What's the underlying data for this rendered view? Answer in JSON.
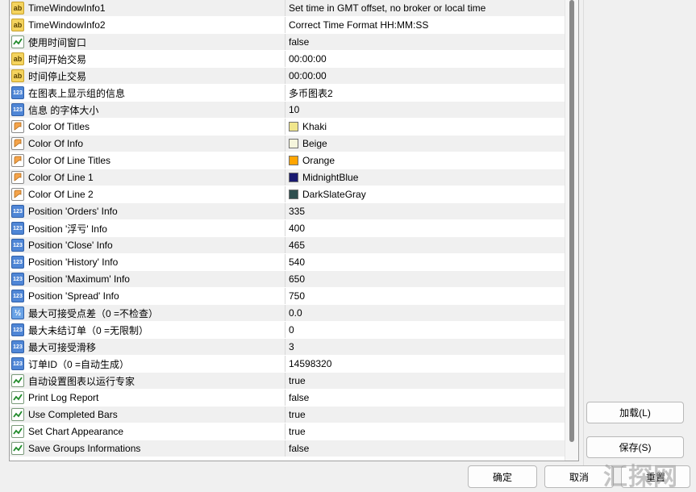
{
  "rows": [
    {
      "name": "TimeWindowInfo1",
      "value": "Set time in GMT offset, no broker or local time",
      "icon": "string-icon"
    },
    {
      "name": "TimeWindowInfo2",
      "value": "Correct Time Format HH:MM:SS",
      "icon": "string-icon"
    },
    {
      "name": "使用时间窗口",
      "value": "false",
      "icon": "bool-icon"
    },
    {
      "name": "时间开始交易",
      "value": "00:00:00",
      "icon": "string-icon"
    },
    {
      "name": "时间停止交易",
      "value": "00:00:00",
      "icon": "string-icon"
    },
    {
      "name": "在图表上显示组的信息",
      "value": "多币图表2",
      "icon": "int-icon"
    },
    {
      "name": "信息 的字体大小",
      "value": "10",
      "icon": "int-icon"
    },
    {
      "name": "Color Of Titles",
      "value": "Khaki",
      "icon": "color-icon",
      "swatch": "#f0e68c"
    },
    {
      "name": "Color Of Info",
      "value": "Beige",
      "icon": "color-icon",
      "swatch": "#f5f5dc"
    },
    {
      "name": "Color Of Line Titles",
      "value": "Orange",
      "icon": "color-icon",
      "swatch": "#ffa500"
    },
    {
      "name": "Color Of Line 1",
      "value": "MidnightBlue",
      "icon": "color-icon",
      "swatch": "#191970"
    },
    {
      "name": "Color Of Line 2",
      "value": "DarkSlateGray",
      "icon": "color-icon",
      "swatch": "#2f4f4f"
    },
    {
      "name": "Position 'Orders' Info",
      "value": "335",
      "icon": "int-icon"
    },
    {
      "name": "Position '浮亏' Info",
      "value": "400",
      "icon": "int-icon"
    },
    {
      "name": "Position 'Close' Info",
      "value": "465",
      "icon": "int-icon"
    },
    {
      "name": "Position 'History' Info",
      "value": "540",
      "icon": "int-icon"
    },
    {
      "name": "Position 'Maximum' Info",
      "value": "650",
      "icon": "int-icon"
    },
    {
      "name": "Position 'Spread' Info",
      "value": "750",
      "icon": "int-icon"
    },
    {
      "name": "最大可接受点差（0 =不检查）",
      "value": "0.0",
      "icon": "double-icon"
    },
    {
      "name": "最大未结订单（0 =无限制）",
      "value": "0",
      "icon": "int-icon"
    },
    {
      "name": "最大可接受滑移",
      "value": "3",
      "icon": "int-icon"
    },
    {
      "name": "订单ID（0 =自动生成）",
      "value": "14598320",
      "icon": "int-icon"
    },
    {
      "name": "自动设置图表以运行专家",
      "value": "true",
      "icon": "bool-icon"
    },
    {
      "name": "Print Log Report",
      "value": "false",
      "icon": "bool-icon"
    },
    {
      "name": "Use Completed Bars",
      "value": "true",
      "icon": "bool-icon"
    },
    {
      "name": "Set Chart Appearance",
      "value": "true",
      "icon": "bool-icon"
    },
    {
      "name": "Save Groups Informations",
      "value": "false",
      "icon": "bool-icon"
    }
  ],
  "icon_text": {
    "string": "ab",
    "int": "123",
    "double": "½"
  },
  "buttons": {
    "load": "加载(L)",
    "save": "保存(S)",
    "ok": "确定",
    "cancel": "取消",
    "reset": "重置"
  },
  "watermark": "汇探网"
}
